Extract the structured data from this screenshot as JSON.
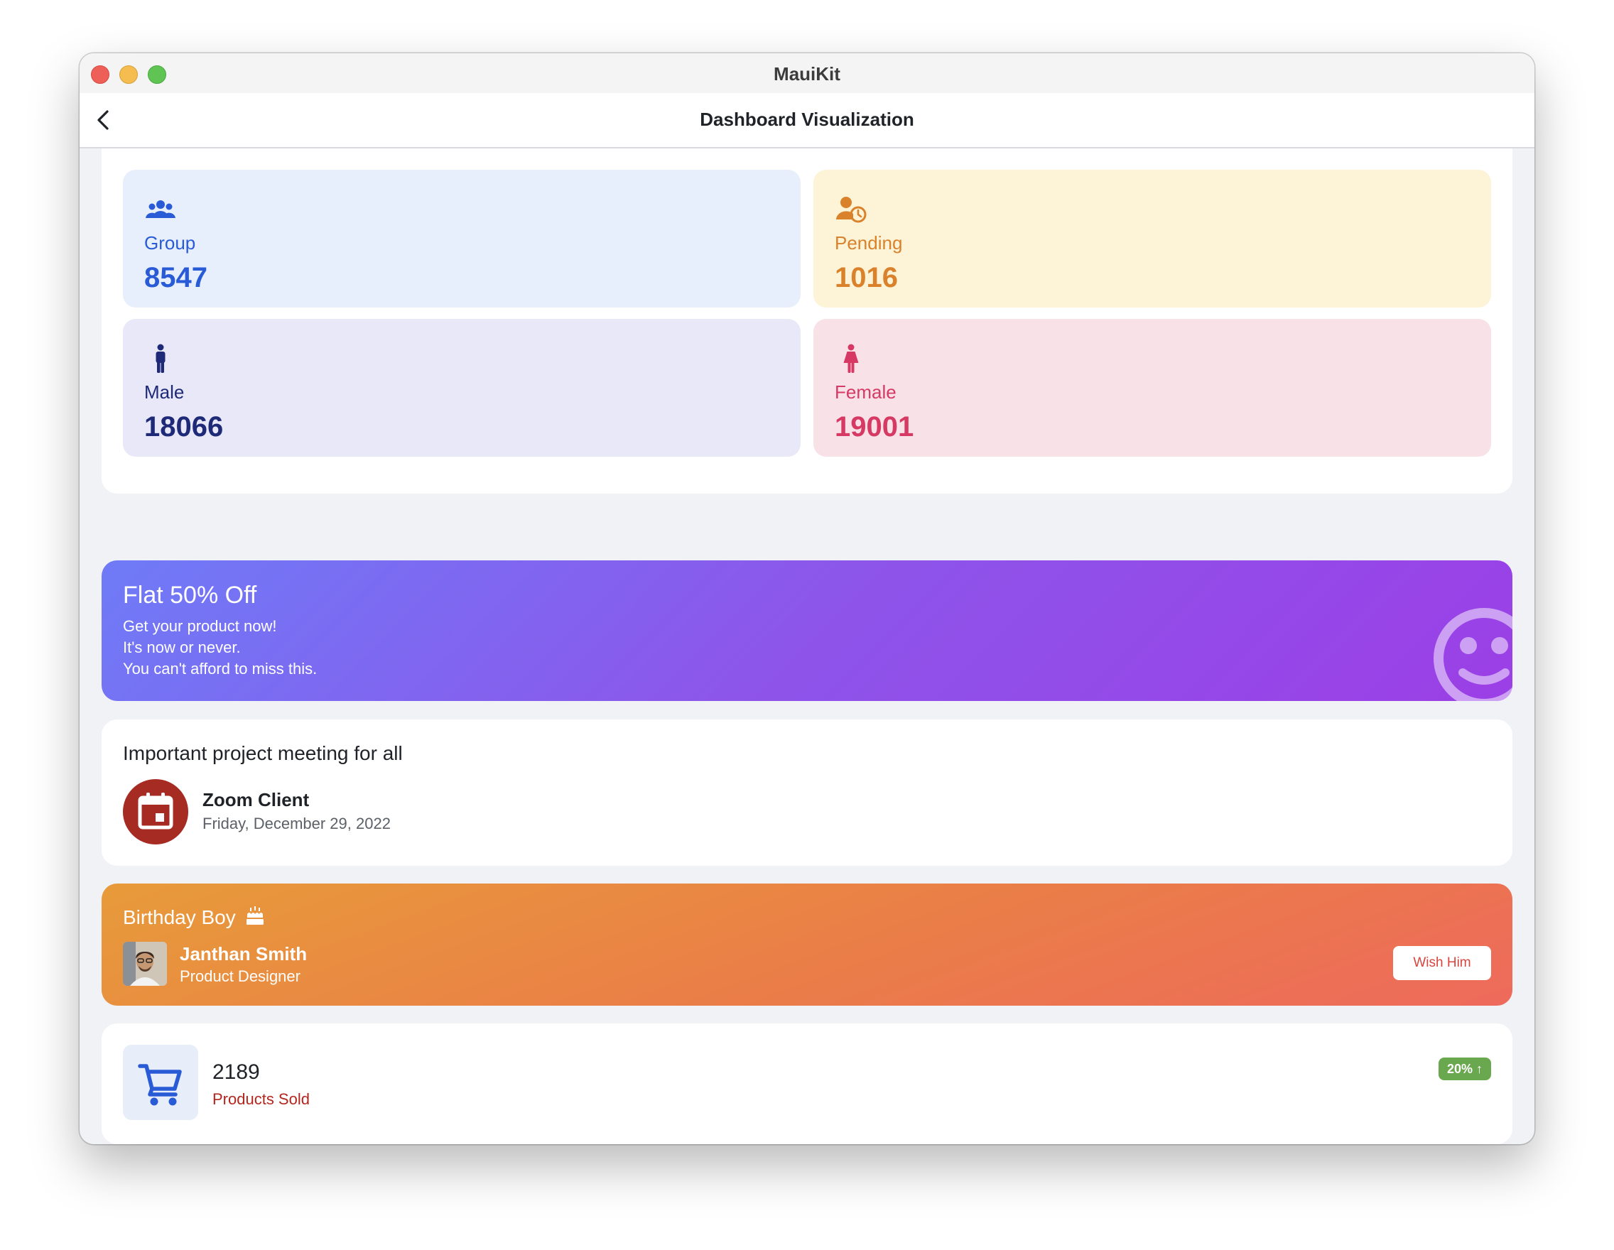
{
  "window": {
    "title": "MauiKit"
  },
  "navbar": {
    "title": "Dashboard Visualization",
    "back_icon": "chevron-left-icon"
  },
  "stats": [
    {
      "label": "Group",
      "value": "8547",
      "icon": "group-icon",
      "bg": "#e8effc",
      "color": "#2a5bd7"
    },
    {
      "label": "Pending",
      "value": "1016",
      "icon": "user-clock-icon",
      "bg": "#fdf3d6",
      "color": "#d9822b"
    },
    {
      "label": "Male",
      "value": "18066",
      "icon": "male-icon",
      "bg": "#e8e8f8",
      "color": "#1e2a78"
    },
    {
      "label": "Female",
      "value": "19001",
      "icon": "female-icon",
      "bg": "#f8e2e8",
      "color": "#d63a64"
    }
  ],
  "promo": {
    "title": "Flat 50% Off",
    "lines": [
      "Get your product now!",
      "It's now or never.",
      "You can't afford to miss this."
    ],
    "icon": "smiley-icon"
  },
  "meeting": {
    "heading": "Important project meeting for all",
    "app": "Zoom Client",
    "date": "Friday, December 29, 2022",
    "icon": "calendar-icon"
  },
  "birthday": {
    "title": "Birthday Boy",
    "icon": "cake-icon",
    "name": "Janthan Smith",
    "role": "Product Designer",
    "button": "Wish Him"
  },
  "sold": {
    "number": "2189",
    "label": "Products Sold",
    "badge": "20%",
    "icon": "cart-icon"
  }
}
